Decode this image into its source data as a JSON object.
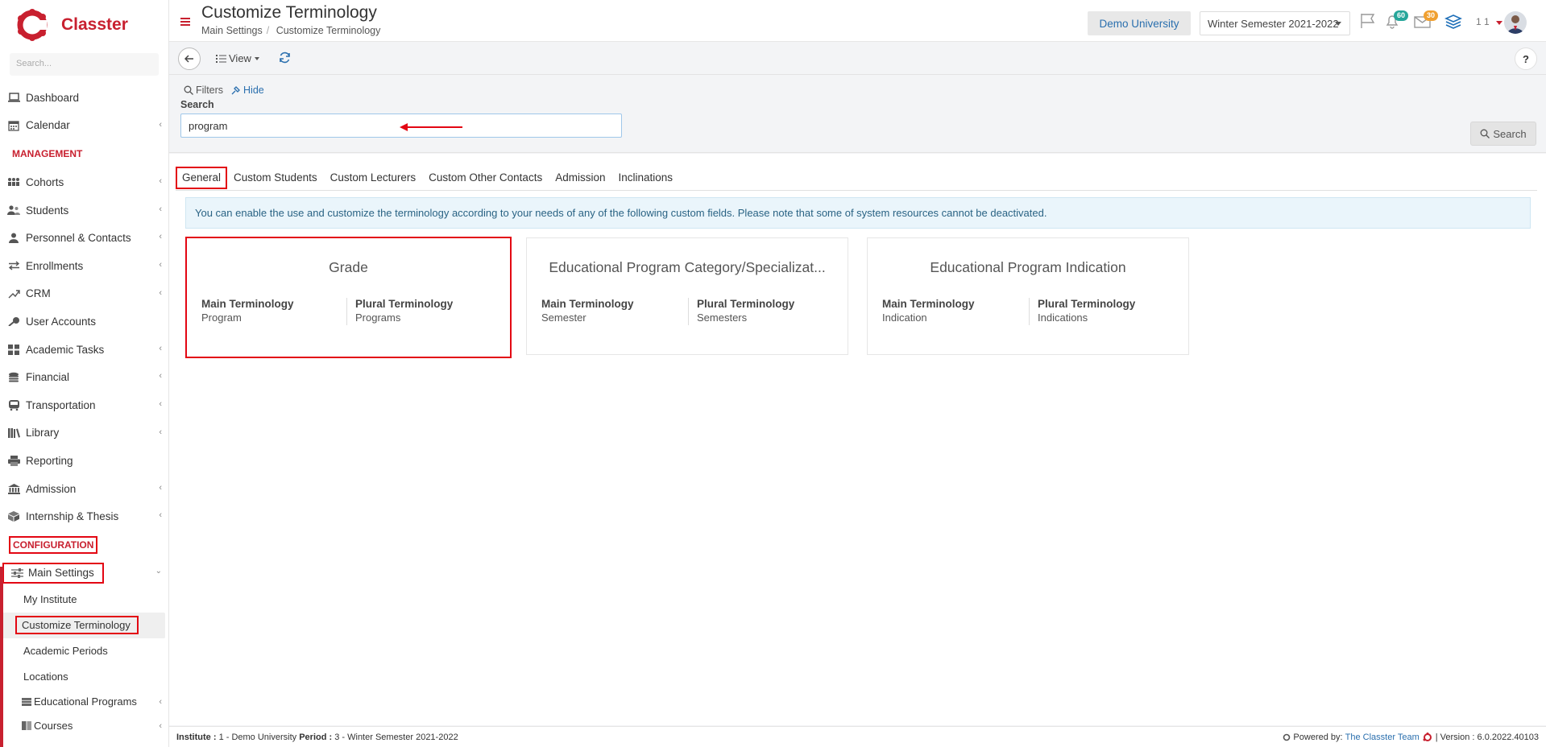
{
  "brand": {
    "name": "Classter"
  },
  "sidebar": {
    "search_placeholder": "Search...",
    "items_top": [
      {
        "label": "Dashboard",
        "icon": "laptop-icon",
        "chevron": false
      },
      {
        "label": "Calendar",
        "icon": "calendar-icon",
        "chevron": true
      }
    ],
    "management_title": "MANAGEMENT",
    "items_management": [
      {
        "label": "Cohorts",
        "icon": "cohorts-icon",
        "chevron": true
      },
      {
        "label": "Students",
        "icon": "students-icon",
        "chevron": true
      },
      {
        "label": "Personnel & Contacts",
        "icon": "person-icon",
        "chevron": true
      },
      {
        "label": "Enrollments",
        "icon": "exchange-icon",
        "chevron": true
      },
      {
        "label": "CRM",
        "icon": "crm-icon",
        "chevron": true
      },
      {
        "label": "User Accounts",
        "icon": "key-icon",
        "chevron": false
      },
      {
        "label": "Academic Tasks",
        "icon": "grid-icon",
        "chevron": true
      },
      {
        "label": "Financial",
        "icon": "coins-icon",
        "chevron": true
      },
      {
        "label": "Transportation",
        "icon": "bus-icon",
        "chevron": true
      },
      {
        "label": "Library",
        "icon": "books-icon",
        "chevron": true
      },
      {
        "label": "Reporting",
        "icon": "printer-icon",
        "chevron": false
      },
      {
        "label": "Admission",
        "icon": "institution-icon",
        "chevron": true
      },
      {
        "label": "Internship & Thesis",
        "icon": "box-icon",
        "chevron": true
      }
    ],
    "config_title": "CONFIGURATION",
    "main_settings": "Main Settings",
    "sub_items": [
      {
        "label": "My Institute"
      },
      {
        "label": "Customize Terminology"
      },
      {
        "label": "Academic Periods"
      },
      {
        "label": "Locations"
      }
    ],
    "sub_items_more": [
      {
        "label": "Educational Programs"
      },
      {
        "label": "Courses"
      }
    ]
  },
  "header": {
    "title": "Customize Terminology",
    "breadcrumb": [
      "Main Settings",
      "Customize Terminology"
    ],
    "institution": "Demo University",
    "period": "Winter Semester 2021-2022",
    "notifications_count": "60",
    "messages_count": "30",
    "user_label": "1 1"
  },
  "toolbar": {
    "view_label": "View",
    "help_label": "?"
  },
  "filters": {
    "filters_label": "Filters",
    "hide_label": "Hide",
    "search_label": "Search",
    "search_value": "program",
    "search_button": "Search"
  },
  "tabs": [
    "General",
    "Custom Students",
    "Custom Lecturers",
    "Custom Other Contacts",
    "Admission",
    "Inclinations"
  ],
  "info_text": "You can enable the use and customize the terminology according to your needs of any of the following custom fields. Please note that some of system resources cannot be deactivated.",
  "cards": [
    {
      "title": "Grade",
      "main_label": "Main Terminology",
      "main_value": "Program",
      "plural_label": "Plural Terminology",
      "plural_value": "Programs"
    },
    {
      "title": "Educational Program Category/Specializat...",
      "main_label": "Main Terminology",
      "main_value": "Semester",
      "plural_label": "Plural Terminology",
      "plural_value": "Semesters"
    },
    {
      "title": "Educational Program Indication",
      "main_label": "Main Terminology",
      "main_value": "Indication",
      "plural_label": "Plural Terminology",
      "plural_value": "Indications"
    }
  ],
  "footer": {
    "institute_label": "Institute :",
    "institute_value": "1 - Demo University",
    "period_label": "Period :",
    "period_value": "3 - Winter Semester 2021-2022",
    "powered_by": "Powered by:",
    "team": "The Classter Team",
    "version": "| Version : 6.0.2022.40103"
  },
  "colors": {
    "brand_red": "#c8202f",
    "link_blue": "#2a6fae",
    "highlight_red": "#e30613"
  }
}
